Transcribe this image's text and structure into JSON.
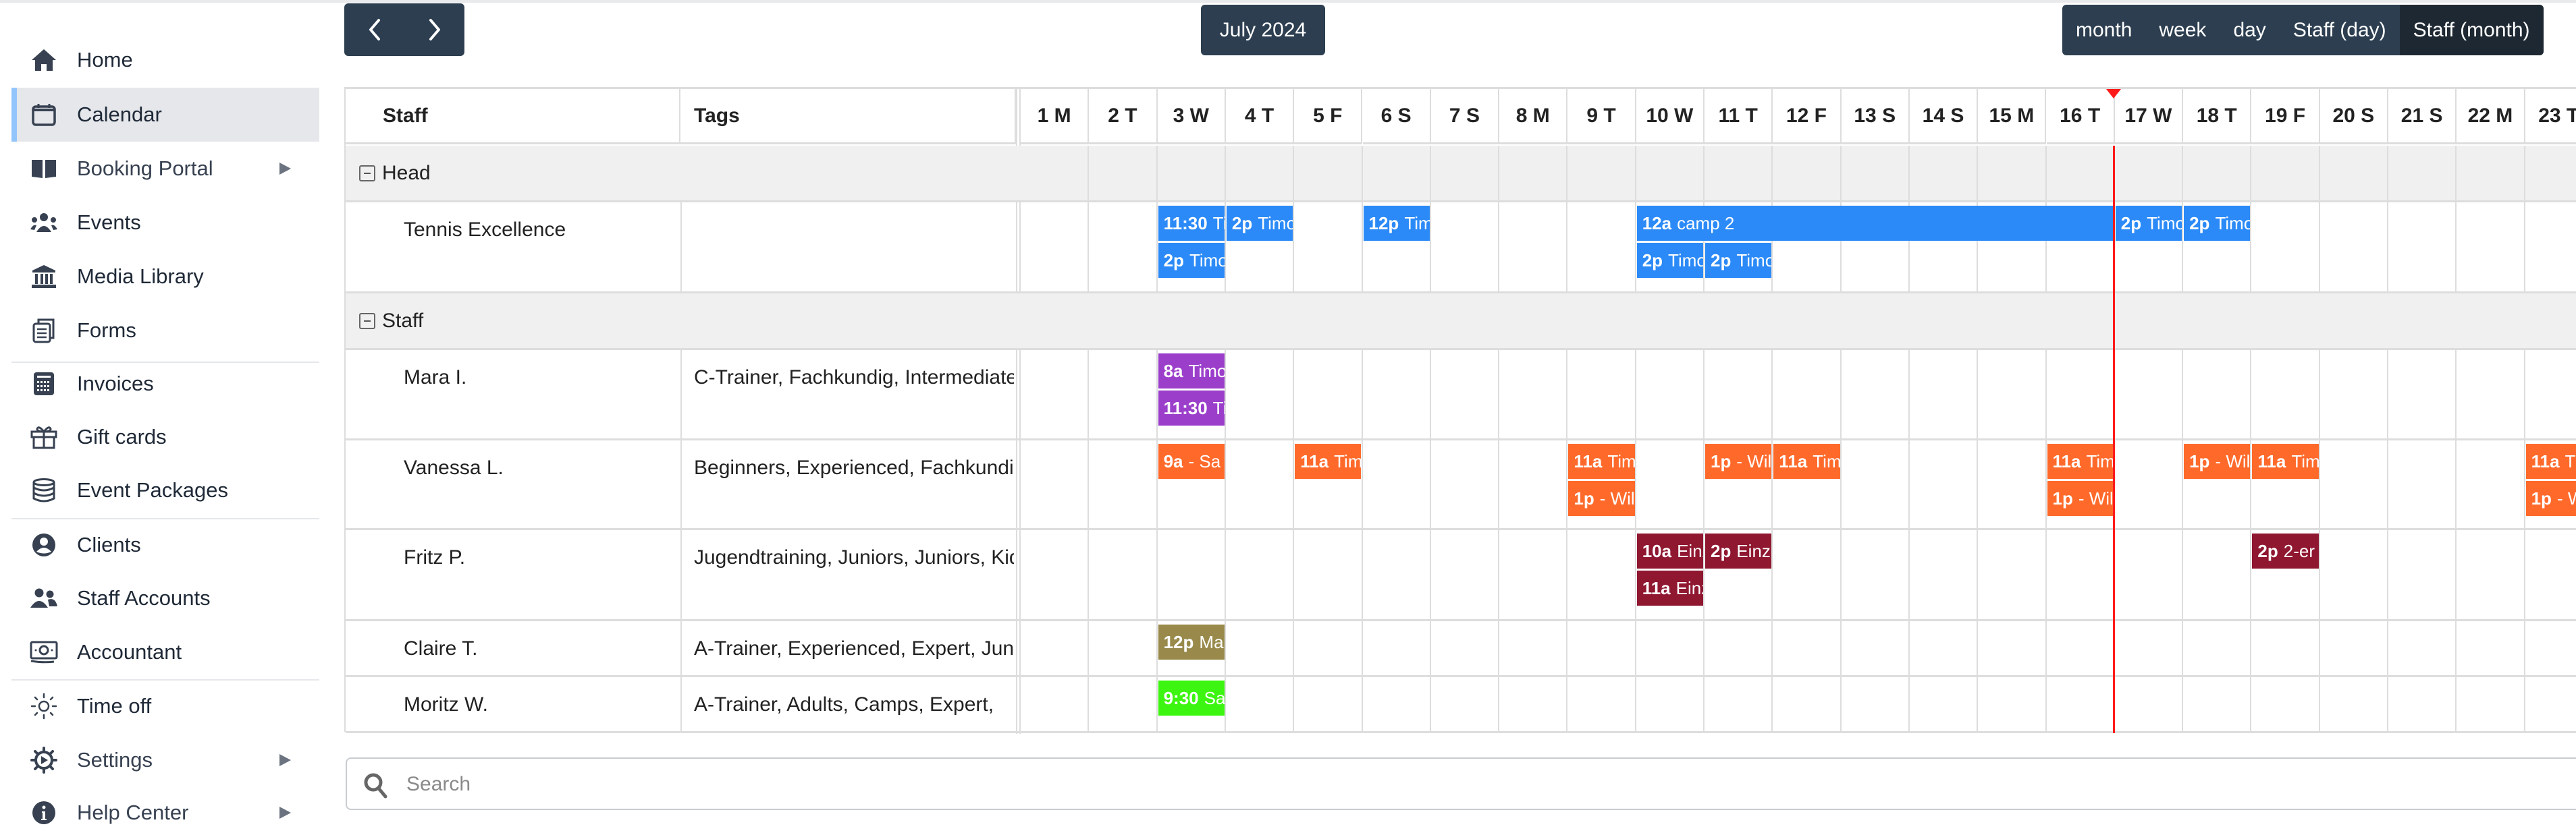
{
  "sidebar": {
    "items": [
      {
        "label": "Home",
        "icon": "home-icon",
        "active": false,
        "submenu": false
      },
      {
        "label": "Calendar",
        "icon": "calendar-icon",
        "active": true,
        "submenu": false
      },
      {
        "label": "Booking Portal",
        "icon": "book-open-icon",
        "active": false,
        "submenu": true
      },
      {
        "label": "Events",
        "icon": "users-group-icon",
        "active": false,
        "submenu": false
      },
      {
        "label": "Media Library",
        "icon": "museum-icon",
        "active": false,
        "submenu": false
      },
      {
        "label": "Forms",
        "icon": "clipboard-icon",
        "active": false,
        "submenu": false
      },
      {
        "label": "Invoices",
        "icon": "calculator-icon",
        "active": false,
        "submenu": false
      },
      {
        "label": "Gift cards",
        "icon": "gift-icon",
        "active": false,
        "submenu": false
      },
      {
        "label": "Event Packages",
        "icon": "database-icon",
        "active": false,
        "submenu": false
      },
      {
        "label": "Clients",
        "icon": "user-circle-icon",
        "active": false,
        "submenu": false
      },
      {
        "label": "Staff Accounts",
        "icon": "user-friends-icon",
        "active": false,
        "submenu": false
      },
      {
        "label": "Accountant",
        "icon": "money-bill-icon",
        "active": false,
        "submenu": false
      },
      {
        "label": "Time off",
        "icon": "sun-icon",
        "active": false,
        "submenu": false
      },
      {
        "label": "Settings",
        "icon": "gear-icon",
        "active": false,
        "submenu": true
      },
      {
        "label": "Help Center",
        "icon": "info-circle-icon",
        "active": false,
        "submenu": true
      }
    ]
  },
  "toolbar": {
    "prev_icon": "chevron-left-icon",
    "next_icon": "chevron-right-icon",
    "title": "July 2024",
    "views": [
      {
        "label": "month",
        "active": false
      },
      {
        "label": "week",
        "active": false
      },
      {
        "label": "day",
        "active": false
      },
      {
        "label": "Staff (day)",
        "active": false
      },
      {
        "label": "Staff (month)",
        "active": true
      }
    ]
  },
  "grid": {
    "columns": {
      "staff": "Staff",
      "tags": "Tags"
    },
    "days": [
      "1 M",
      "2 T",
      "3 W",
      "4 T",
      "5 F",
      "6 S",
      "7 S",
      "8 M",
      "9 T",
      "10 W",
      "11 T",
      "12 F",
      "13 S",
      "14 S",
      "15 M",
      "16 T",
      "17 W",
      "18 T",
      "19 F",
      "20 S",
      "21 S",
      "22 M",
      "23 T"
    ],
    "now_marker": {
      "after_day": 16
    },
    "groups": [
      {
        "label": "Head",
        "resources": [
          {
            "name": "Tennis Excellence",
            "tags": "",
            "events": [
              {
                "day": 3,
                "span": 1,
                "lane": 0,
                "time": "11:30",
                "title": "Timo",
                "color": "#2b8af7"
              },
              {
                "day": 3,
                "span": 1,
                "lane": 1,
                "time": "2p",
                "title": "Timo",
                "color": "#2b8af7"
              },
              {
                "day": 4,
                "span": 1,
                "lane": 0,
                "time": "2p",
                "title": "Timo",
                "color": "#2b8af7"
              },
              {
                "day": 6,
                "span": 1,
                "lane": 0,
                "time": "12p",
                "title": "Timo",
                "color": "#2b8af7"
              },
              {
                "day": 10,
                "span": 7,
                "lane": 0,
                "time": "12a",
                "title": "camp 2",
                "color": "#2b8af7"
              },
              {
                "day": 17,
                "span": 1,
                "lane": 0,
                "time": "2p",
                "title": "Timo",
                "color": "#2b8af7"
              },
              {
                "day": 18,
                "span": 1,
                "lane": 0,
                "time": "2p",
                "title": "Timo",
                "color": "#2b8af7"
              },
              {
                "day": 10,
                "span": 1,
                "lane": 1,
                "time": "2p",
                "title": "Timo",
                "color": "#2b8af7"
              },
              {
                "day": 11,
                "span": 1,
                "lane": 1,
                "time": "2p",
                "title": "Timo",
                "color": "#2b8af7"
              }
            ]
          }
        ]
      },
      {
        "label": "Staff",
        "resources": [
          {
            "name": "Mara I.",
            "tags": "C-Trainer, Fachkundig, Intermediate",
            "events": [
              {
                "day": 3,
                "span": 1,
                "lane": 0,
                "time": "8a",
                "title": "Timo",
                "color": "#9b3fcb"
              },
              {
                "day": 3,
                "span": 1,
                "lane": 1,
                "time": "11:30",
                "title": "Timo",
                "color": "#9b3fcb"
              }
            ]
          },
          {
            "name": "Vanessa L.",
            "tags": "Beginners, Experienced, Fachkundig",
            "events": [
              {
                "day": 3,
                "span": 1,
                "lane": 0,
                "time": "9a",
                "title": "- Sa",
                "color": "#ff6a2b"
              },
              {
                "day": 5,
                "span": 1,
                "lane": 0,
                "time": "11a",
                "title": "Timo",
                "color": "#ff6a2b"
              },
              {
                "day": 9,
                "span": 1,
                "lane": 0,
                "time": "11a",
                "title": "Timo",
                "color": "#ff6a2b"
              },
              {
                "day": 9,
                "span": 1,
                "lane": 1,
                "time": "1p",
                "title": "- Wil",
                "color": "#ff6a2b"
              },
              {
                "day": 11,
                "span": 1,
                "lane": 0,
                "time": "1p",
                "title": "- Wil",
                "color": "#ff6a2b"
              },
              {
                "day": 12,
                "span": 1,
                "lane": 0,
                "time": "11a",
                "title": "Timo",
                "color": "#ff6a2b"
              },
              {
                "day": 16,
                "span": 1,
                "lane": 0,
                "time": "11a",
                "title": "Timo",
                "color": "#ff6a2b"
              },
              {
                "day": 16,
                "span": 1,
                "lane": 1,
                "time": "1p",
                "title": "- Wil",
                "color": "#ff6a2b"
              },
              {
                "day": 18,
                "span": 1,
                "lane": 0,
                "time": "1p",
                "title": "- Wil",
                "color": "#ff6a2b"
              },
              {
                "day": 19,
                "span": 1,
                "lane": 0,
                "time": "11a",
                "title": "Timo",
                "color": "#ff6a2b"
              },
              {
                "day": 23,
                "span": 1,
                "lane": 0,
                "time": "11a",
                "title": "Timo",
                "color": "#ff6a2b"
              },
              {
                "day": 23,
                "span": 1,
                "lane": 1,
                "time": "1p",
                "title": "- Wil",
                "color": "#ff6a2b"
              }
            ]
          },
          {
            "name": "Fritz P.",
            "tags": "Jugendtraining, Juniors, Juniors, Kids",
            "events": [
              {
                "day": 10,
                "span": 1,
                "lane": 0,
                "time": "10a",
                "title": "Einz",
                "color": "#8f1730"
              },
              {
                "day": 10,
                "span": 1,
                "lane": 1,
                "time": "11a",
                "title": "Einz",
                "color": "#8f1730"
              },
              {
                "day": 11,
                "span": 1,
                "lane": 0,
                "time": "2p",
                "title": "Einz",
                "color": "#8f1730"
              },
              {
                "day": 19,
                "span": 1,
                "lane": 0,
                "time": "2p",
                "title": "2-er",
                "color": "#8f1730"
              }
            ]
          },
          {
            "name": "Claire T.",
            "tags": "A-Trainer, Experienced, Expert, Juniors",
            "events": [
              {
                "day": 3,
                "span": 1,
                "lane": 0,
                "time": "12p",
                "title": "Ma",
                "color": "#998a4b"
              }
            ]
          },
          {
            "name": "Moritz W.",
            "tags": "A-Trainer, Adults, Camps, Expert, ",
            "events": [
              {
                "day": 3,
                "span": 1,
                "lane": 0,
                "time": "9:30",
                "title": "Sa",
                "color": "#3cf510"
              }
            ]
          }
        ]
      }
    ]
  },
  "search": {
    "placeholder": "Search",
    "value": ""
  }
}
